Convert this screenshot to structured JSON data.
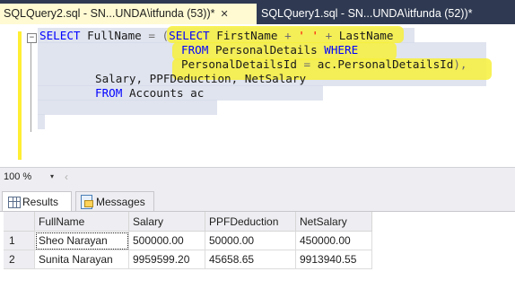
{
  "tabs": {
    "active_label": "SQLQuery2.sql - SN...UNDA\\itfunda (53))*",
    "active_close": "✕",
    "inactive_label": "SQLQuery1.sql - SN...UNDA\\itfunda (52))*"
  },
  "editor": {
    "collapse_symbol": "−",
    "line1": {
      "kw_select": "SELECT",
      "fullname": "FullName",
      "eq": "=",
      "paren_open": "(",
      "kw_select2": "SELECT",
      "firstname": "FirstName",
      "plus1": "+",
      "space_str": "' '",
      "plus2": "+",
      "lastname": "LastName"
    },
    "line2": {
      "kw_from": "FROM",
      "table": "PersonalDetails",
      "kw_where": "WHERE"
    },
    "line3": {
      "col": "PersonalDetailsId",
      "eq": "=",
      "ref": "ac.PersonalDetailsId",
      "close": "),"
    },
    "line4": {
      "cols": "Salary, PPFDeduction, NetSalary"
    },
    "line5": {
      "kw_from": "FROM",
      "table": "Accounts ac"
    }
  },
  "zoom": {
    "value": "100 %",
    "caret": "▾",
    "scroll_left": "‹"
  },
  "result_tabs": {
    "results": "Results",
    "messages": "Messages"
  },
  "grid": {
    "headers": [
      "FullName",
      "Salary",
      "PPFDeduction",
      "NetSalary"
    ],
    "rows": [
      {
        "num": "1",
        "FullName": "Sheo Narayan",
        "Salary": "500000.00",
        "PPFDeduction": "50000.00",
        "NetSalary": "450000.00"
      },
      {
        "num": "2",
        "FullName": "Sunita Narayan",
        "Salary": "9959599.20",
        "PPFDeduction": "45658.65",
        "NetSalary": "9913940.55"
      }
    ]
  }
}
